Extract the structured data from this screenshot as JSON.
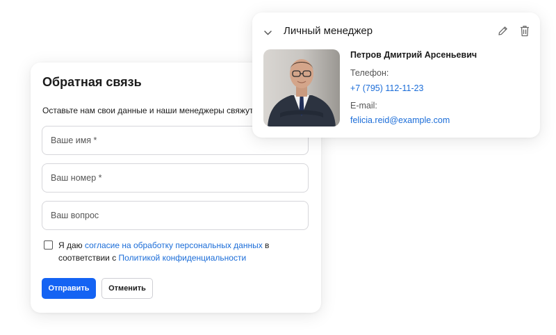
{
  "form": {
    "title": "Обратная связь",
    "description": "Оставьте нам свои данные и наши менеджеры свяжутся с вами",
    "name_placeholder": "Ваше имя *",
    "phone_placeholder": "Ваш номер *",
    "question_placeholder": "Ваш вопрос",
    "consent": {
      "prefix": "Я даю ",
      "consent_link": "согласие на обработку персональных данных",
      "middle": " в соответствии с ",
      "policy_link": "Политикой конфиденциальности"
    },
    "submit_label": "Отправить",
    "cancel_label": "Отменить"
  },
  "manager": {
    "header": "Личный менеджер",
    "name": "Петров Дмитрий Арсеньевич",
    "phone_label": "Телефон:",
    "phone": "+7 (795) 112-11-23",
    "email_label": "E-mail:",
    "email": "felicia.reid@example.com",
    "icons": {
      "collapse": "chevron-down-icon",
      "edit": "pencil-icon",
      "delete": "trash-icon"
    }
  },
  "colors": {
    "accent": "#1463f3",
    "link": "#1a6cd8"
  }
}
